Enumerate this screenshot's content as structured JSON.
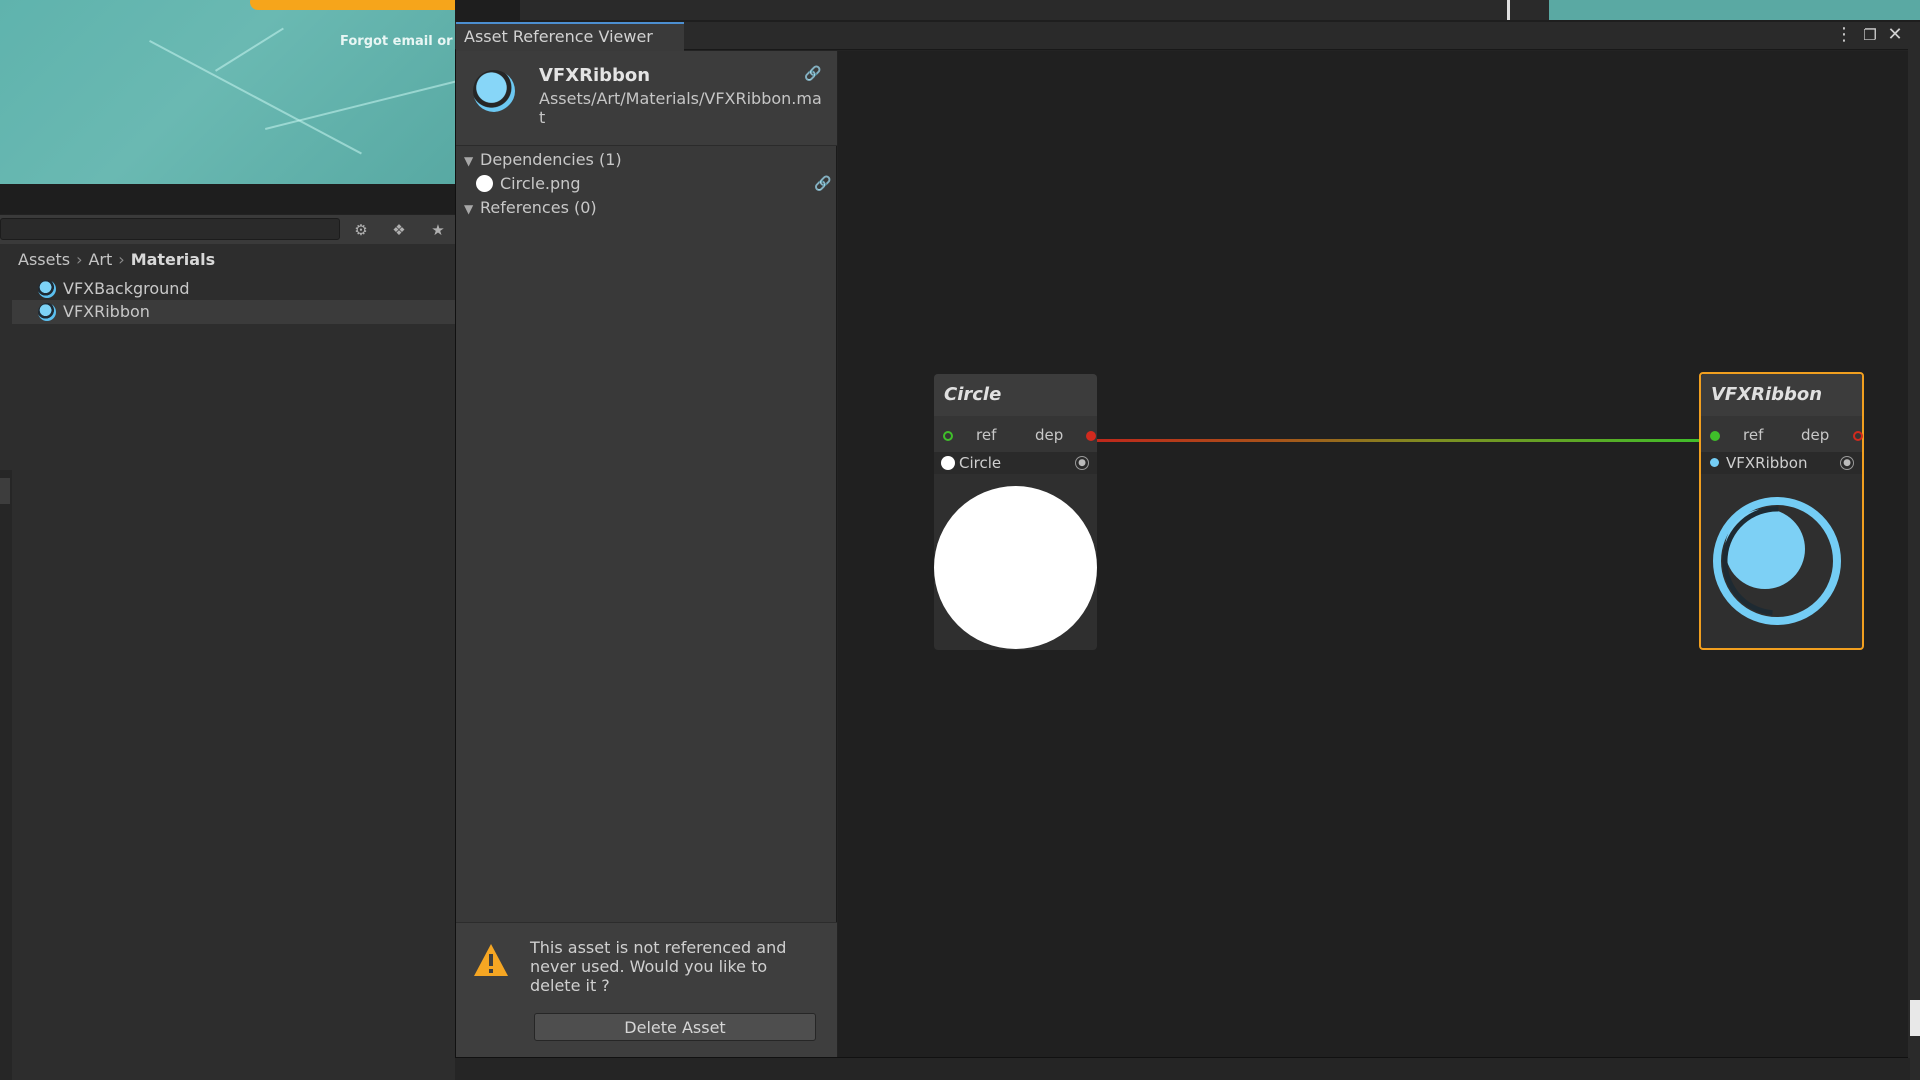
{
  "background": {
    "game_view_text": "Forgot email or"
  },
  "project": {
    "breadcrumb": [
      "Assets",
      "Art",
      "Materials"
    ],
    "files": [
      {
        "label": "VFXBackground",
        "selected": false
      },
      {
        "label": "VFXRibbon",
        "selected": true
      }
    ],
    "toolbar_icons": [
      "filter-by-type-icon",
      "filter-by-label-icon",
      "favorite-star-icon"
    ]
  },
  "window": {
    "tab_title": "Asset Reference Viewer",
    "controls": [
      "more-options-icon",
      "maximize-icon",
      "close-icon"
    ]
  },
  "asset": {
    "name": "VFXRibbon",
    "path": "Assets/Art/Materials/VFXRibbon.mat"
  },
  "tree": {
    "dependencies_label": "Dependencies (1)",
    "dependencies": [
      {
        "label": "Circle.png"
      }
    ],
    "references_label": "References (0)"
  },
  "warning": {
    "message": "This asset is not referenced and never used. Would you like to delete it ?",
    "button_label": "Delete Asset"
  },
  "graph": {
    "nodes": [
      {
        "title": "Circle",
        "port_ref": "ref",
        "port_dep": "dep",
        "asset_label": "Circle"
      },
      {
        "title": "VFXRibbon",
        "port_ref": "ref",
        "port_dep": "dep",
        "asset_label": "VFXRibbon"
      }
    ]
  },
  "colors": {
    "accent_tab": "#4c8fd1",
    "selected_node_border": "#f19f1f",
    "warning": "#f5a623",
    "material_blue": "#74cdf5",
    "connection_start": "#c0261b",
    "connection_end": "#3fbf2a"
  }
}
